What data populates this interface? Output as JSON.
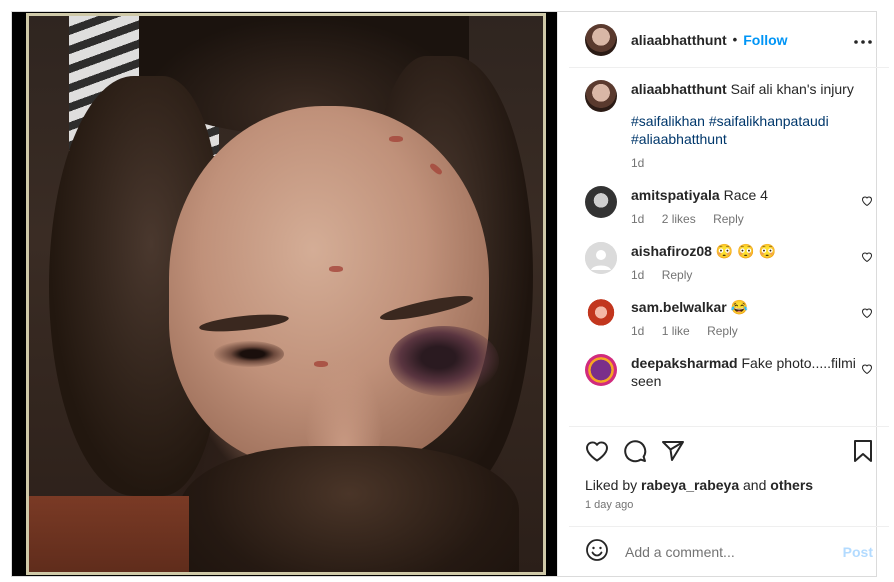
{
  "post": {
    "author": "aliaabhatthunt",
    "follow_label": "Follow",
    "separator": "•",
    "more_icon": "more-icon",
    "caption_user": "aliaabhatthunt",
    "caption_text": "Saif ali khan's injury",
    "hashtags": "#saifalikhan #saifalikhanpataudi #aliaabhatthunt",
    "caption_time": "1d"
  },
  "comments": [
    {
      "user": "amitspatiyala",
      "text": "Race 4",
      "time": "1d",
      "likes": "2 likes",
      "reply": "Reply"
    },
    {
      "user": "aishafiroz08",
      "text": "😳 😳 😳",
      "time": "1d",
      "likes": "",
      "reply": "Reply"
    },
    {
      "user": "sam.belwalkar",
      "text": "😂",
      "time": "1d",
      "likes": "1 like",
      "reply": "Reply"
    },
    {
      "user": "deepaksharmad",
      "text": "Fake photo.....filmi seen",
      "time": "",
      "likes": "",
      "reply": ""
    }
  ],
  "footer": {
    "liked_by_prefix": "Liked by ",
    "liked_by_user": "rabeya_rabeya",
    "liked_by_and": " and ",
    "liked_by_others": "others",
    "time_ago": "1 day ago",
    "comment_placeholder": "Add a comment...",
    "post_label": "Post"
  },
  "colors": {
    "link_blue": "#0095f6",
    "hashtag": "#00376b",
    "muted": "#737373"
  }
}
